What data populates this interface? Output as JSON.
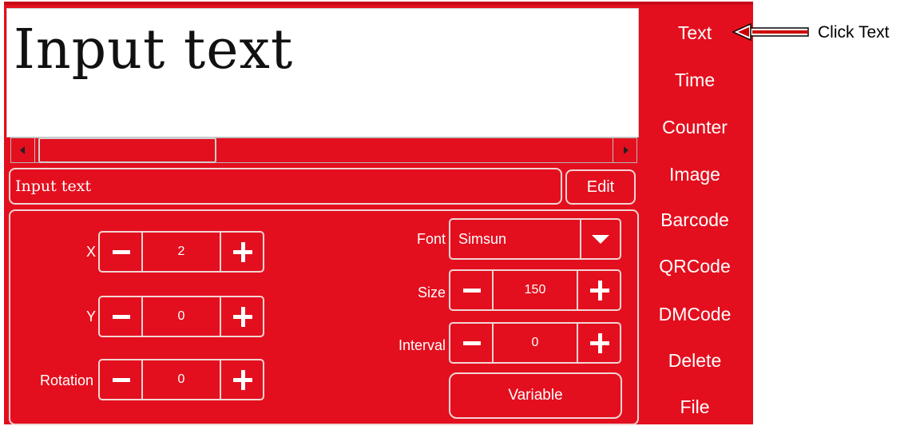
{
  "preview": {
    "text": "Input text"
  },
  "text_field": {
    "value": "Input text"
  },
  "edit_label": "Edit",
  "properties": {
    "x": {
      "label": "X",
      "value": "2"
    },
    "y": {
      "label": "Y",
      "value": "0"
    },
    "rotation": {
      "label": "Rotation",
      "value": "0"
    },
    "font": {
      "label": "Font",
      "value": "Simsun"
    },
    "size": {
      "label": "Size",
      "value": "150"
    },
    "interval": {
      "label": "Interval",
      "value": "0"
    },
    "variable_label": "Variable"
  },
  "menu": [
    {
      "label": "Text"
    },
    {
      "label": "Time"
    },
    {
      "label": "Counter"
    },
    {
      "label": "Image"
    },
    {
      "label": "Barcode"
    },
    {
      "label": "QRCode"
    },
    {
      "label": "DMCode"
    },
    {
      "label": "Delete"
    },
    {
      "label": "File"
    }
  ],
  "annotation": {
    "label": "Click Text"
  },
  "colors": {
    "panel_bg": "#e30f1e",
    "border": "#f2d4d4",
    "text": "#ffffff"
  }
}
